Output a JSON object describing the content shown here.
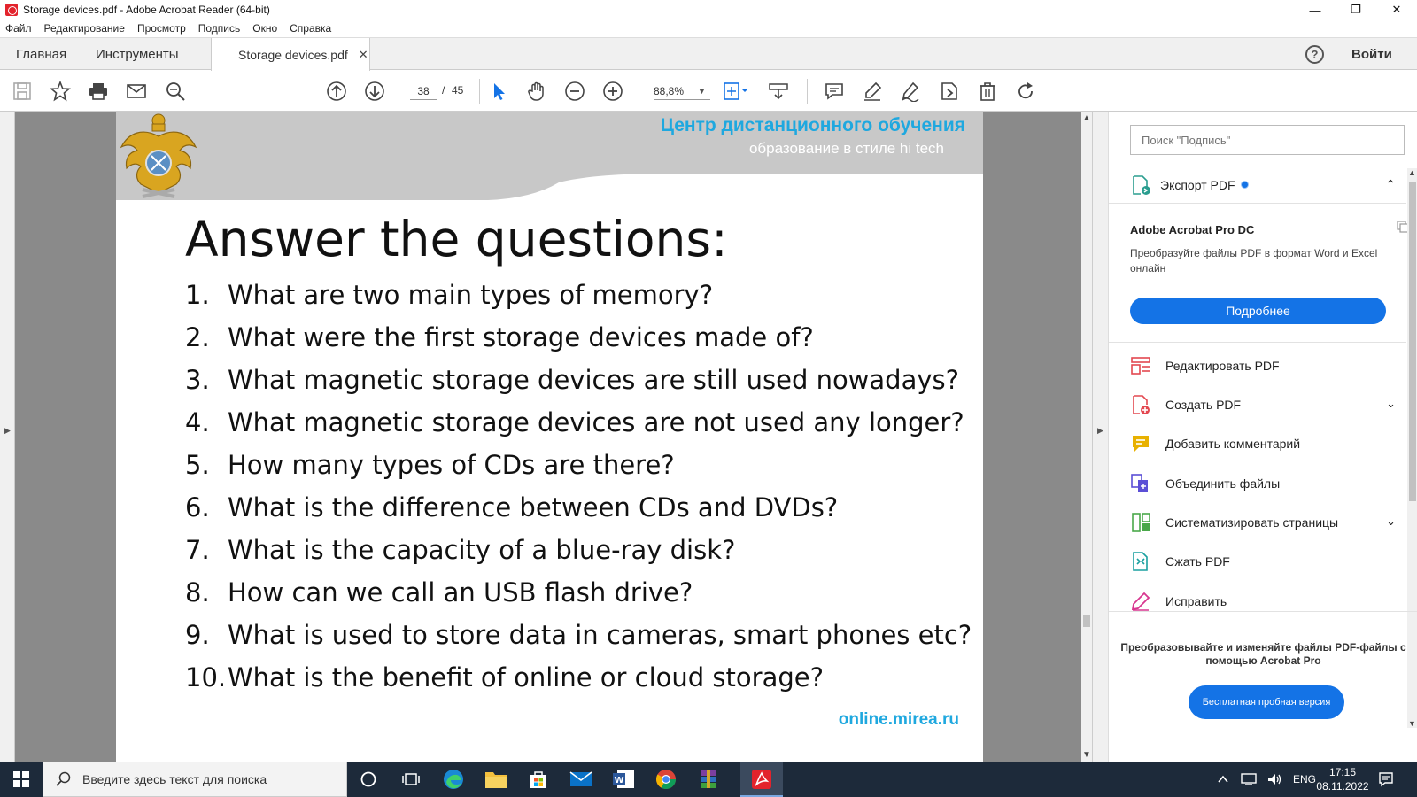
{
  "window": {
    "title": "Storage devices.pdf - Adobe Acrobat Reader (64-bit)",
    "controls": {
      "minimize": "—",
      "maximize": "❐",
      "close": "✕"
    }
  },
  "menu": [
    "Файл",
    "Редактирование",
    "Просмотр",
    "Подпись",
    "Окно",
    "Справка"
  ],
  "tabs": {
    "home": "Главная",
    "tools": "Инструменты",
    "document": "Storage devices.pdf",
    "close": "✕"
  },
  "header_actions": {
    "help": "?",
    "signin": "Войти"
  },
  "toolbar": {
    "page_current": "38",
    "page_sep": "/",
    "page_total": "45",
    "zoom": "88,8%",
    "zoom_caret": "▼"
  },
  "page": {
    "center_title": "Центр дистанционного обучения",
    "center_subtitle": "образование в стиле hi tech",
    "heading": "Answer the questions:",
    "questions": [
      {
        "num": "1.",
        "text": "What are two main types of memory?"
      },
      {
        "num": "2.",
        "text": "What were the first storage devices made of?"
      },
      {
        "num": "3.",
        "text": "What magnetic storage devices are still used nowadays?"
      },
      {
        "num": "4.",
        "text": "What magnetic storage devices are not used any longer?"
      },
      {
        "num": "5.",
        "text": "How many types of CDs are there?"
      },
      {
        "num": "6.",
        "text": "What is the difference between CDs and DVDs?"
      },
      {
        "num": "7.",
        "text": "What is the capacity of a blue-ray disk?"
      },
      {
        "num": "8.",
        "text": "How can we call an USB flash drive?"
      },
      {
        "num": "9.",
        "text": "What is used to store data in cameras, smart phones etc?"
      },
      {
        "num": "10.",
        "text": "What is the benefit of online or cloud storage?"
      }
    ],
    "footer_url": "online.mirea.ru"
  },
  "scroll_arrows": {
    "up": "▲",
    "down": "▼",
    "left": "◀",
    "right": "▶"
  },
  "right_panel": {
    "search_placeholder": "Поиск \"Подпись\"",
    "export_label": "Экспорт PDF",
    "export_chevron": "⌃",
    "promo_title": "Adobe Acrobat Pro DC",
    "promo_text": "Преобразуйте файлы PDF в формат Word и Excel онлайн",
    "promo_button": "Подробнее",
    "tools": [
      {
        "label": "Редактировать PDF",
        "icon": "edit-pdf-icon",
        "color": "#e34850",
        "chevron": ""
      },
      {
        "label": "Создать PDF",
        "icon": "create-pdf-icon",
        "color": "#e34850",
        "chevron": "⌄"
      },
      {
        "label": "Добавить комментарий",
        "icon": "comment-icon",
        "color": "#e8b100",
        "chevron": ""
      },
      {
        "label": "Объединить файлы",
        "icon": "combine-files-icon",
        "color": "#5b4fd6",
        "chevron": ""
      },
      {
        "label": "Систематизировать страницы",
        "icon": "organize-pages-icon",
        "color": "#4aa84a",
        "chevron": "⌄"
      },
      {
        "label": "Сжать PDF",
        "icon": "compress-pdf-icon",
        "color": "#1aa0a0",
        "chevron": ""
      },
      {
        "label": "Исправить",
        "icon": "fill-sign-icon",
        "color": "#d83790",
        "chevron": ""
      }
    ],
    "bottom_promo": "Преобразовывайте и изменяйте файлы PDF-файлы с помощью Acrobat Pro",
    "trial_button": "Бесплатная пробная версия"
  },
  "taskbar": {
    "search_placeholder": "Введите здесь текст для поиска",
    "language": "ENG",
    "time": "17:15",
    "date": "08.11.2022"
  },
  "colors": {
    "accent_blue": "#1473e6",
    "mirea_cyan": "#1fa8df",
    "adobe_red": "#e3232c",
    "taskbar": "#1d2a3a"
  }
}
